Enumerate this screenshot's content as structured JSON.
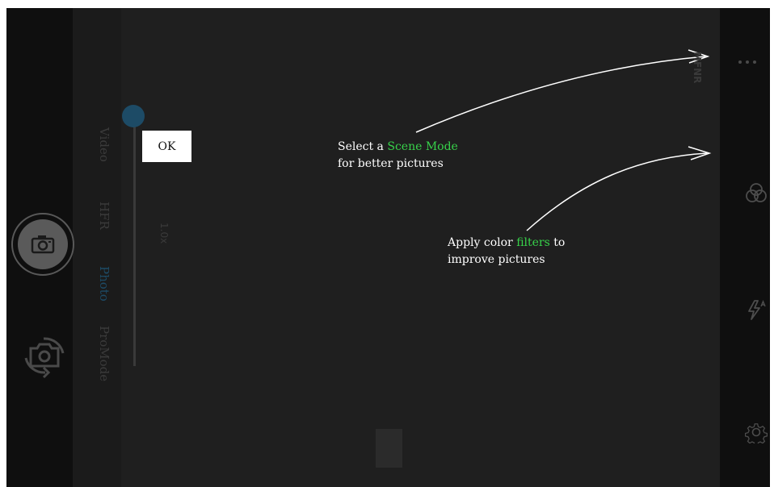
{
  "modes": [
    {
      "label": "Video",
      "active": false
    },
    {
      "label": "HFR",
      "active": false
    },
    {
      "label": "Photo",
      "active": true
    },
    {
      "label": "ProMode",
      "active": false
    }
  ],
  "zoom": {
    "label": "1.0x",
    "level": 0
  },
  "ok_button": {
    "label": "OK"
  },
  "hints": {
    "scene": {
      "prefix": "Select a ",
      "highlight": "Scene Mode",
      "line2": "for better pictures"
    },
    "filters": {
      "prefix": "Apply color ",
      "highlight": "filters",
      "suffix": " to",
      "line2": "improve pictures"
    }
  },
  "top_right_label": "MFNR",
  "icons": {
    "shutter": "camera-icon",
    "switch": "switch-camera-icon",
    "more": "more-dots-icon",
    "filters": "color-filters-icon",
    "flash": "flash-auto-icon",
    "settings": "gear-icon"
  },
  "colors": {
    "accent": "#1d4b66",
    "highlight": "#37d24a"
  }
}
